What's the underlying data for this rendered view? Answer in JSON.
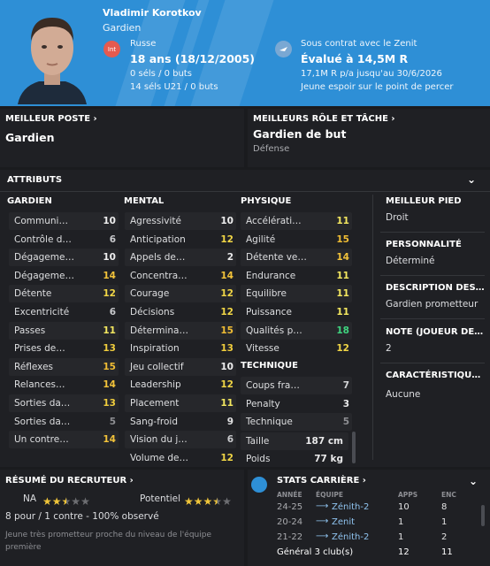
{
  "header": {
    "name": "Vladimir Korotkov",
    "position": "Gardien",
    "flag_label": "Int",
    "nationality": "Russe",
    "age": "18 ans (18/12/2005)",
    "caps": "0 séls / 0 buts",
    "u21_caps": "14 séls U21 / 0 buts",
    "contract": "Sous contrat avec le Zenit",
    "value": "Évalué à 14,5M R",
    "wage": "17,1M R p/a jusqu'au 30/6/2026",
    "tagline": "Jeune espoir sur le point de percer",
    "accent": "#2e8fd6"
  },
  "best_position": {
    "title": "MEILLEUR POSTE",
    "value": "Gardien"
  },
  "best_role": {
    "title": "MEILLEURS RÔLE ET TÂCHE",
    "value": "Gardien de but",
    "duty": "Défense"
  },
  "attributes": {
    "title": "ATTRIBUTS",
    "gk": {
      "title": "GARDIEN",
      "items": [
        {
          "n": "Communi…",
          "v": "10"
        },
        {
          "n": "Contrôle d…",
          "v": "6"
        },
        {
          "n": "Dégageme…",
          "v": "10"
        },
        {
          "n": "Dégageme…",
          "v": "14"
        },
        {
          "n": "Détente",
          "v": "12"
        },
        {
          "n": "Excentricité",
          "v": "6"
        },
        {
          "n": "Passes",
          "v": "11"
        },
        {
          "n": "Prises de…",
          "v": "13"
        },
        {
          "n": "Réflexes",
          "v": "15"
        },
        {
          "n": "Relances…",
          "v": "14"
        },
        {
          "n": "Sorties da…",
          "v": "13"
        },
        {
          "n": "Sorties da…",
          "v": "5"
        },
        {
          "n": "Un contre…",
          "v": "14"
        }
      ]
    },
    "mental": {
      "title": "MENTAL",
      "items": [
        {
          "n": "Agressivité",
          "v": "10"
        },
        {
          "n": "Anticipation",
          "v": "12"
        },
        {
          "n": "Appels de…",
          "v": "2"
        },
        {
          "n": "Concentra…",
          "v": "14"
        },
        {
          "n": "Courage",
          "v": "12"
        },
        {
          "n": "Décisions",
          "v": "12"
        },
        {
          "n": "Détermina…",
          "v": "15"
        },
        {
          "n": "Inspiration",
          "v": "13"
        },
        {
          "n": "Jeu collectif",
          "v": "10"
        },
        {
          "n": "Leadership",
          "v": "12"
        },
        {
          "n": "Placement",
          "v": "11"
        },
        {
          "n": "Sang-froid",
          "v": "9"
        },
        {
          "n": "Vision du j…",
          "v": "6"
        },
        {
          "n": "Volume de…",
          "v": "12"
        }
      ]
    },
    "physical": {
      "title": "PHYSIQUE",
      "items": [
        {
          "n": "Accélérati…",
          "v": "11"
        },
        {
          "n": "Agilité",
          "v": "15"
        },
        {
          "n": "Détente ve…",
          "v": "14"
        },
        {
          "n": "Endurance",
          "v": "11"
        },
        {
          "n": "Équilibre",
          "v": "11"
        },
        {
          "n": "Puissance",
          "v": "11"
        },
        {
          "n": "Qualités p…",
          "v": "18"
        },
        {
          "n": "Vitesse",
          "v": "12"
        }
      ]
    },
    "technical": {
      "title": "TECHNIQUE",
      "items": [
        {
          "n": "Coups fra…",
          "v": "7"
        },
        {
          "n": "Penalty",
          "v": "3"
        },
        {
          "n": "Technique",
          "v": "5"
        }
      ]
    },
    "height_label": "Taille",
    "height": "187 cm",
    "weight_label": "Poids",
    "weight": "77 kg"
  },
  "side": {
    "foot_title": "MEILLEUR PIED",
    "foot": "Droit",
    "pers_title": "PERSONNALITÉ",
    "pers": "Déterminé",
    "desc_title": "DESCRIPTION DES…",
    "desc": "Gardien prometteur",
    "note_title": "NOTE (JOUEUR DE…",
    "note": "2",
    "char_title": "CARACTÉRISTIQU…",
    "char": "Aucune"
  },
  "scout": {
    "title": "RÉSUMÉ DU RECRUTEUR",
    "na_label": "NA",
    "potential_label": "Potentiel",
    "na_stars": 2.5,
    "potential_stars": 3.5,
    "report": "8 pour / 1 contre - 100% observé",
    "comment": "Jeune très prometteur proche du niveau de l'équipe première"
  },
  "career": {
    "title": "STATS CARRIÈRE",
    "headers": [
      "ANNÉE",
      "ÉQUIPE",
      "APPS",
      "ENC"
    ],
    "rows": [
      {
        "year": "24-25",
        "team": "Zénith-2",
        "apps": "10",
        "enc": "8"
      },
      {
        "year": "20-24",
        "team": "Zenit",
        "apps": "1",
        "enc": "1"
      },
      {
        "year": "21-22",
        "team": "Zénith-2",
        "apps": "1",
        "enc": "2"
      }
    ],
    "total": "Général 3 club(s)",
    "total_apps": "12",
    "total_enc": "11"
  }
}
